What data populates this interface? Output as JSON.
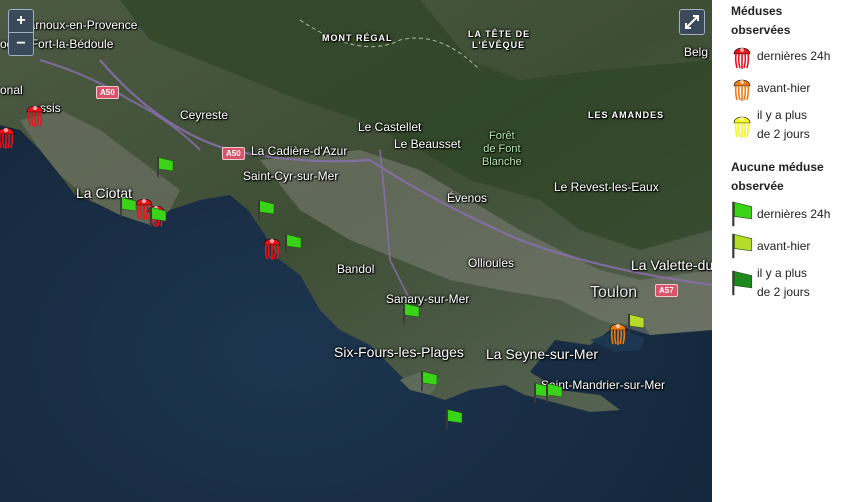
{
  "map": {
    "places": [
      {
        "name": "Carnoux-en-Provence",
        "kind": "town"
      },
      {
        "name": "oque-Fort-la-Bédoule",
        "kind": "town"
      },
      {
        "name": "onal",
        "kind": "town"
      },
      {
        "name": "ssis",
        "kind": "town"
      },
      {
        "name": "Ceyreste",
        "kind": "town"
      },
      {
        "name": "La Cadière-d'Azur",
        "kind": "town"
      },
      {
        "name": "Saint-Cyr-sur-Mer",
        "kind": "town"
      },
      {
        "name": "La Ciotat",
        "kind": "city"
      },
      {
        "name": "Le Castellet",
        "kind": "town"
      },
      {
        "name": "Le Beausset",
        "kind": "town"
      },
      {
        "name": "Évenos",
        "kind": "town"
      },
      {
        "name": "Bandol",
        "kind": "town"
      },
      {
        "name": "Ollioules",
        "kind": "town"
      },
      {
        "name": "Sanary-sur-Mer",
        "kind": "town"
      },
      {
        "name": "Six-Fours-les-Plages",
        "kind": "city"
      },
      {
        "name": "La Seyne-sur-Mer",
        "kind": "city"
      },
      {
        "name": "Saint-Mandrier-sur-Mer",
        "kind": "town"
      },
      {
        "name": "Le Revest-les-Eaux",
        "kind": "town"
      },
      {
        "name": "La Valette-du-",
        "kind": "city"
      },
      {
        "name": "Toulon",
        "kind": "city"
      },
      {
        "name": "Belg",
        "kind": "town"
      }
    ],
    "regions": [
      "MONT RÉGAL",
      "LA TÊTE DE",
      "L'ÉVÊQUE",
      "LES AMANDES"
    ],
    "forest": [
      "Forêt",
      "de Font",
      "Blanche"
    ],
    "roads": [
      "A50",
      "A50",
      "A57"
    ],
    "controls": {
      "zoom_in": "+",
      "zoom_out": "−"
    },
    "colors": {
      "jelly_24h": "#e8141b",
      "jelly_avant_hier": "#f07a12",
      "jelly_old": "#f5f51e",
      "flag_24h": "#39d417",
      "flag_avant_hier": "#b6dc2a",
      "flag_old": "#1e8a1e"
    }
  },
  "legend": {
    "observed_title_1": "Méduses",
    "observed_title_2": "observées",
    "observed": [
      {
        "icon": "jellyfish-red-icon",
        "line1": "dernières 24h",
        "line2": ""
      },
      {
        "icon": "jellyfish-orange-icon",
        "line1": "avant-hier",
        "line2": ""
      },
      {
        "icon": "jellyfish-yellow-icon",
        "line1": "il y a plus",
        "line2": "de 2 jours"
      }
    ],
    "none_title_1": "Aucune méduse",
    "none_title_2": "observée",
    "none": [
      {
        "icon": "flag-green-icon",
        "line1": "dernières 24h",
        "line2": ""
      },
      {
        "icon": "flag-lime-icon",
        "line1": "avant-hier",
        "line2": ""
      },
      {
        "icon": "flag-darkgreen-icon",
        "line1": "il y a plus",
        "line2": "de 2 jours"
      }
    ]
  }
}
